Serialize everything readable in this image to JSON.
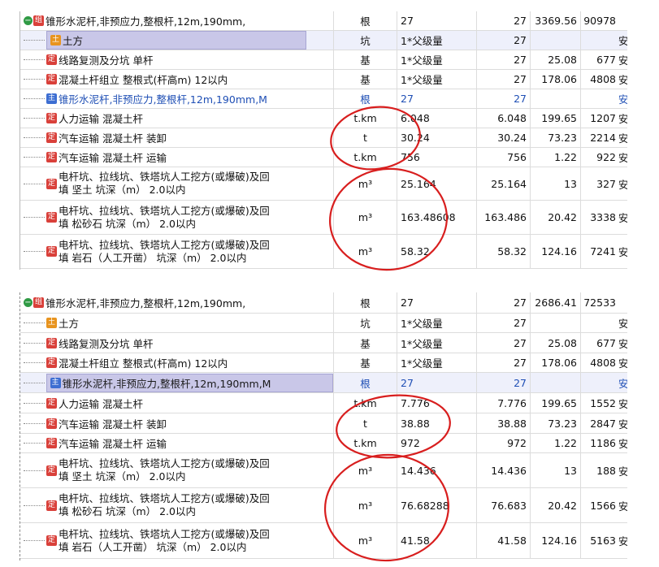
{
  "colors": {
    "accent_red": "#d9403a",
    "group_green": "#2f9a44",
    "blue_text": "#1f4fb5",
    "selection": "#c9c7e8"
  },
  "icons": {
    "group": "组",
    "tufang": "土",
    "ding": "定",
    "zhu": "主"
  },
  "panels": [
    {
      "rows": [
        {
          "type": "group",
          "icon": "组",
          "name": "锥形水泥杆,非预应力,整根杆,12m,190mm,",
          "unit": "根",
          "qexp": "27",
          "qty": "27",
          "price": "3369.56",
          "total": "90978",
          "flag": ""
        },
        {
          "type": "tufang",
          "icon": "土",
          "name": "土方",
          "unit": "坑",
          "qexp": "1*父级量",
          "qty": "27",
          "price": "",
          "total": "",
          "flag": "安"
        },
        {
          "type": "ding",
          "icon": "定",
          "name": "线路复测及分坑 单杆",
          "unit": "基",
          "qexp": "1*父级量",
          "qty": "27",
          "price": "25.08",
          "total": "677",
          "flag": "安"
        },
        {
          "type": "ding",
          "icon": "定",
          "name": "混凝土杆组立 整根式(杆高m) 12以内",
          "unit": "基",
          "qexp": "1*父级量",
          "qty": "27",
          "price": "178.06",
          "total": "4808",
          "flag": "安"
        },
        {
          "type": "zhu",
          "icon": "主",
          "name": "锥形水泥杆,非预应力,整根杆,12m,190mm,M",
          "unit": "根",
          "qexp": "27",
          "qty": "27",
          "price": "",
          "total": "",
          "flag": "安"
        },
        {
          "type": "ding",
          "icon": "定",
          "name": "人力运输 混凝土杆",
          "unit": "t.km",
          "qexp": "6.048",
          "qty": "6.048",
          "price": "199.65",
          "total": "1207",
          "flag": "安"
        },
        {
          "type": "ding",
          "icon": "定",
          "name": "汽车运输 混凝土杆 装卸",
          "unit": "t",
          "qexp": "30.24",
          "qty": "30.24",
          "price": "73.23",
          "total": "2214",
          "flag": "安"
        },
        {
          "type": "ding",
          "icon": "定",
          "name": "汽车运输 混凝土杆 运输",
          "unit": "t.km",
          "qexp": "756",
          "qty": "756",
          "price": "1.22",
          "total": "922",
          "flag": "安"
        },
        {
          "type": "ding2",
          "icon": "定",
          "name": "电杆坑、拉线坑、铁塔坑人工挖方(或爆破)及回",
          "name2": "填 坚土 坑深（m） 2.0以内",
          "unit": "m³",
          "qexp": "25.164",
          "qty": "25.164",
          "price": "13",
          "total": "327",
          "flag": "安"
        },
        {
          "type": "ding2",
          "icon": "定",
          "name": "电杆坑、拉线坑、铁塔坑人工挖方(或爆破)及回",
          "name2": "填 松砂石 坑深（m） 2.0以内",
          "unit": "m³",
          "qexp": "163.48608",
          "qty": "163.486",
          "price": "20.42",
          "total": "3338",
          "flag": "安"
        },
        {
          "type": "ding2",
          "icon": "定",
          "name": "电杆坑、拉线坑、铁塔坑人工挖方(或爆破)及回",
          "name2": "填 岩石（人工开凿） 坑深（m） 2.0以内",
          "unit": "m³",
          "qexp": "58.32",
          "qty": "58.32",
          "price": "124.16",
          "total": "7241",
          "flag": "安"
        }
      ]
    },
    {
      "rows": [
        {
          "type": "group",
          "icon": "组",
          "name": "锥形水泥杆,非预应力,整根杆,12m,190mm,",
          "unit": "根",
          "qexp": "27",
          "qty": "27",
          "price": "2686.41",
          "total": "72533",
          "flag": ""
        },
        {
          "type": "tufang",
          "icon": "土",
          "name": "土方",
          "unit": "坑",
          "qexp": "1*父级量",
          "qty": "27",
          "price": "",
          "total": "",
          "flag": "安"
        },
        {
          "type": "ding",
          "icon": "定",
          "name": "线路复测及分坑 单杆",
          "unit": "基",
          "qexp": "1*父级量",
          "qty": "27",
          "price": "25.08",
          "total": "677",
          "flag": "安"
        },
        {
          "type": "ding",
          "icon": "定",
          "name": "混凝土杆组立 整根式(杆高m) 12以内",
          "unit": "基",
          "qexp": "1*父级量",
          "qty": "27",
          "price": "178.06",
          "total": "4808",
          "flag": "安"
        },
        {
          "type": "zhu",
          "icon": "主",
          "name": "锥形水泥杆,非预应力,整根杆,12m,190mm,M",
          "unit": "根",
          "qexp": "27",
          "qty": "27",
          "price": "",
          "total": "",
          "flag": "安"
        },
        {
          "type": "ding",
          "icon": "定",
          "name": "人力运输 混凝土杆",
          "unit": "t.km",
          "qexp": "7.776",
          "qty": "7.776",
          "price": "199.65",
          "total": "1552",
          "flag": "安"
        },
        {
          "type": "ding",
          "icon": "定",
          "name": "汽车运输 混凝土杆 装卸",
          "unit": "t",
          "qexp": "38.88",
          "qty": "38.88",
          "price": "73.23",
          "total": "2847",
          "flag": "安"
        },
        {
          "type": "ding",
          "icon": "定",
          "name": "汽车运输 混凝土杆 运输",
          "unit": "t.km",
          "qexp": "972",
          "qty": "972",
          "price": "1.22",
          "total": "1186",
          "flag": "安"
        },
        {
          "type": "ding2",
          "icon": "定",
          "name": "电杆坑、拉线坑、铁塔坑人工挖方(或爆破)及回",
          "name2": "填 坚土 坑深（m） 2.0以内",
          "unit": "m³",
          "qexp": "14.436",
          "qty": "14.436",
          "price": "13",
          "total": "188",
          "flag": "安"
        },
        {
          "type": "ding2",
          "icon": "定",
          "name": "电杆坑、拉线坑、铁塔坑人工挖方(或爆破)及回",
          "name2": "填 松砂石 坑深（m） 2.0以内",
          "unit": "m³",
          "qexp": "76.68288",
          "qty": "76.683",
          "price": "20.42",
          "total": "1566",
          "flag": "安"
        },
        {
          "type": "ding2",
          "icon": "定",
          "name": "电杆坑、拉线坑、铁塔坑人工挖方(或爆破)及回",
          "name2": "填 岩石（人工开凿） 坑深（m） 2.0以内",
          "unit": "m³",
          "qexp": "41.58",
          "qty": "41.58",
          "price": "124.16",
          "total": "5163",
          "flag": "安"
        }
      ]
    }
  ]
}
